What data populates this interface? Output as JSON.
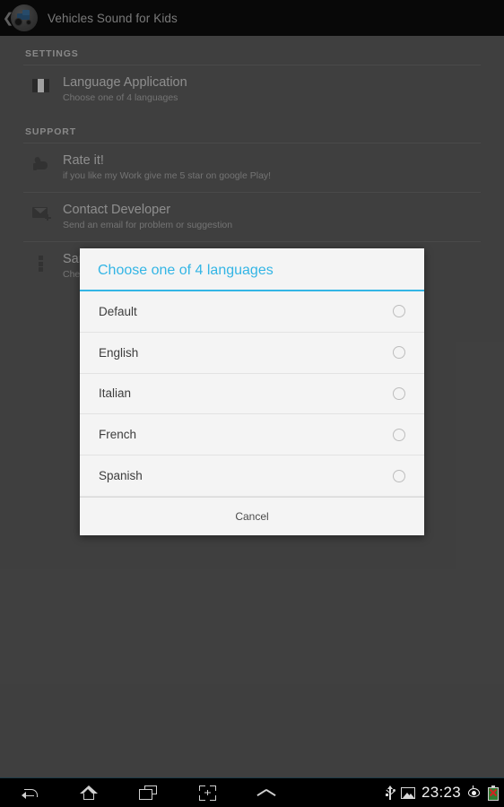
{
  "appbar": {
    "back_icon": "chevron-left-icon",
    "app_icon": "tractor-app-icon",
    "title": "Vehicles Sound for Kids"
  },
  "preferences": {
    "sections": [
      {
        "header": "SETTINGS",
        "rows": [
          {
            "icon": "flag-icon",
            "title": "Language Application",
            "subtitle": "Choose one of 4 languages"
          }
        ]
      },
      {
        "header": "SUPPORT",
        "rows": [
          {
            "icon": "thumbs-up-icon",
            "title": "Rate it!",
            "subtitle": "if you like my Work give me 5 star on google Play!"
          },
          {
            "icon": "mail-add-icon",
            "title": "Contact Developer",
            "subtitle": "Send an email for problem or suggestion"
          },
          {
            "icon": "more-dots-icon",
            "title": "SamApplix Works",
            "subtitle": "Check out other app on Google play!"
          }
        ]
      }
    ]
  },
  "dialog": {
    "title": "Choose one of 4 languages",
    "accent_color": "#33b5e5",
    "options": [
      {
        "label": "Default",
        "selected": false
      },
      {
        "label": "English",
        "selected": false
      },
      {
        "label": "Italian",
        "selected": false
      },
      {
        "label": "French",
        "selected": false
      },
      {
        "label": "Spanish",
        "selected": false
      }
    ],
    "cancel_label": "Cancel"
  },
  "navbar": {
    "buttons": [
      {
        "icon": "back-icon"
      },
      {
        "icon": "home-icon"
      },
      {
        "icon": "recents-icon"
      },
      {
        "icon": "screenshot-icon"
      },
      {
        "icon": "chevron-up-icon"
      }
    ],
    "status": {
      "usb_icon": "usb-icon",
      "screenshot_icon": "image-icon",
      "clock": "23:23",
      "eye_icon": "eye-icon",
      "battery_icon": "battery-error-icon"
    }
  }
}
